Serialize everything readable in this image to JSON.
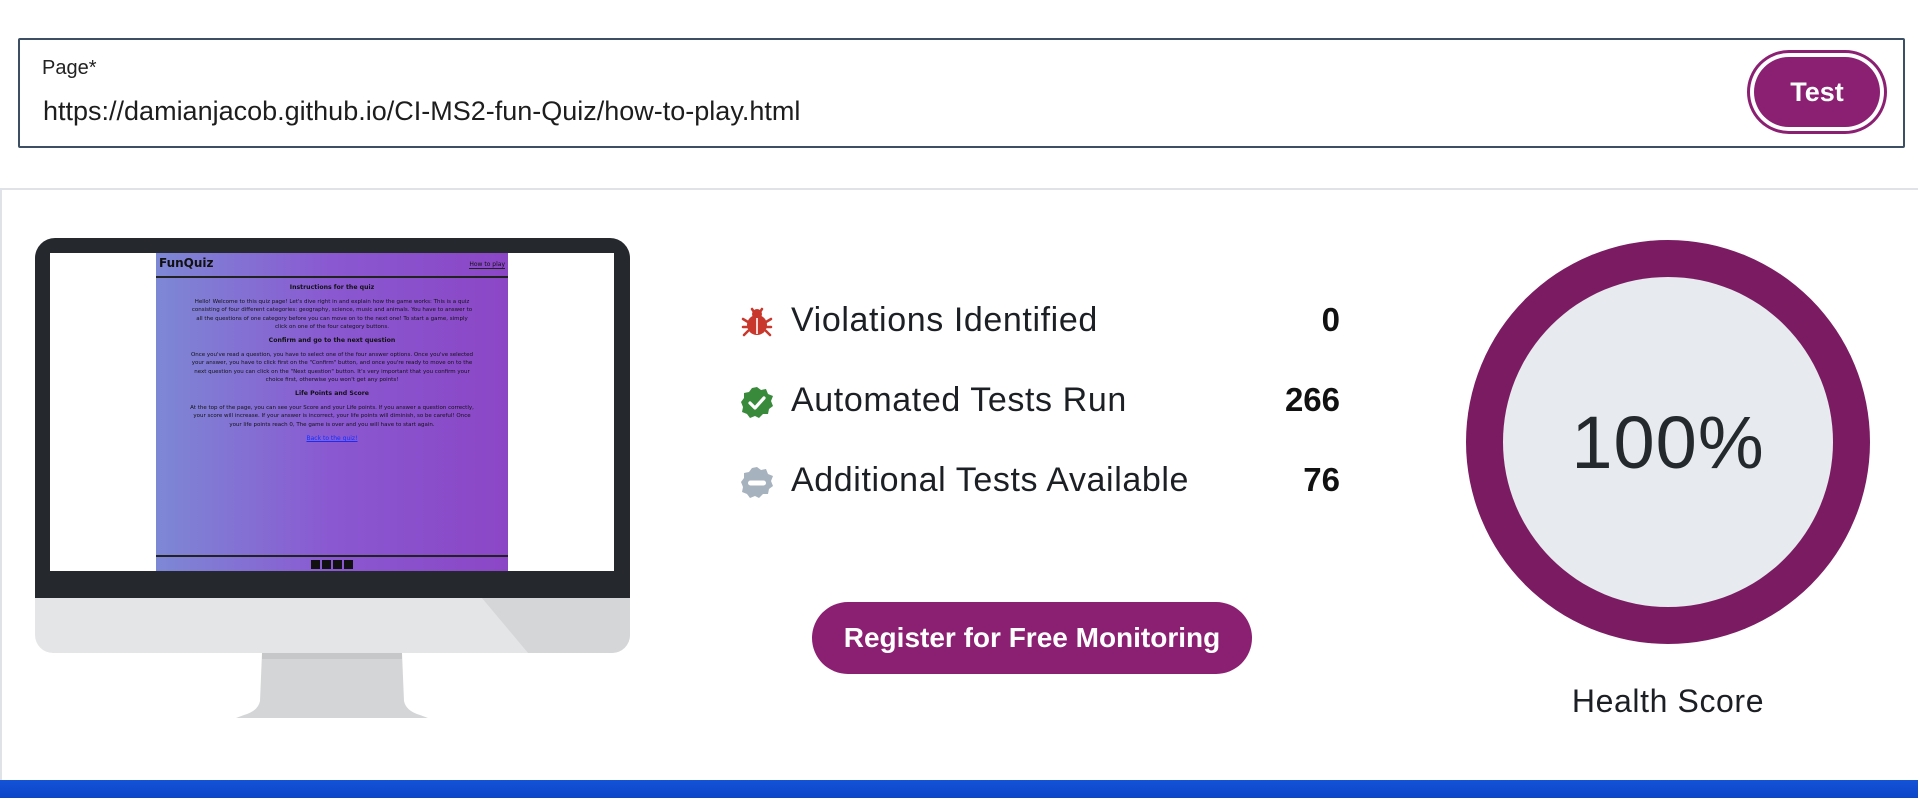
{
  "url_field": {
    "label": "Page",
    "required_marker": "*",
    "value": "https://damianjacob.github.io/CI-MS2-fun-Quiz/how-to-play.html"
  },
  "test_button": {
    "label": "Test"
  },
  "preview": {
    "logo": "FunQuiz",
    "nav_link": "How to play",
    "sections": [
      {
        "heading": "Instructions for the quiz",
        "text": "Hello! Welcome to this quiz page! Let's dive right in and explain how the game works: This is a quiz consisting of four different categories: geography, science, music and animals. You have to answer to all the questions of one category before you can move on to the next one! To start a game, simply click on one of the four category buttons."
      },
      {
        "heading": "Confirm and go to the next question",
        "text": "Once you've read a question, you have to select one of the four answer options. Once you've selected your answer, you have to click first on the \"Confirm\" button, and once you're ready to move on to the next question you can click on the \"Next question\" button. It's very important that you confirm your choice first, otherwise you won't get any points!"
      },
      {
        "heading": "Life Points and Score",
        "text": "At the top of the page, you can see your Score and your Life points. If you answer a question correctly, your score will increase. If your answer is incorrect, your life points will diminish, so be careful! Once your life points reach 0, The game is over and you will have to start again."
      }
    ],
    "back_link": "Back to the quiz!"
  },
  "stats": [
    {
      "icon": "bug-icon",
      "label": "Violations Identified",
      "value": "0"
    },
    {
      "icon": "check-badge-icon",
      "label": "Automated Tests Run",
      "value": "266"
    },
    {
      "icon": "minus-badge-icon",
      "label": "Additional Tests Available",
      "value": "76"
    }
  ],
  "register_button": {
    "label": "Register for Free Monitoring"
  },
  "health": {
    "value": "100%",
    "label": "Health Score"
  },
  "colors": {
    "brand": "#8b1f71",
    "gauge_ring": "#7b1c63",
    "gauge_fill": "#e7eaee",
    "bug_red": "#c8382c",
    "check_green": "#3a8a3c",
    "neutral_gray": "#a7b2bf",
    "bottom_bar": "#1452d6"
  }
}
